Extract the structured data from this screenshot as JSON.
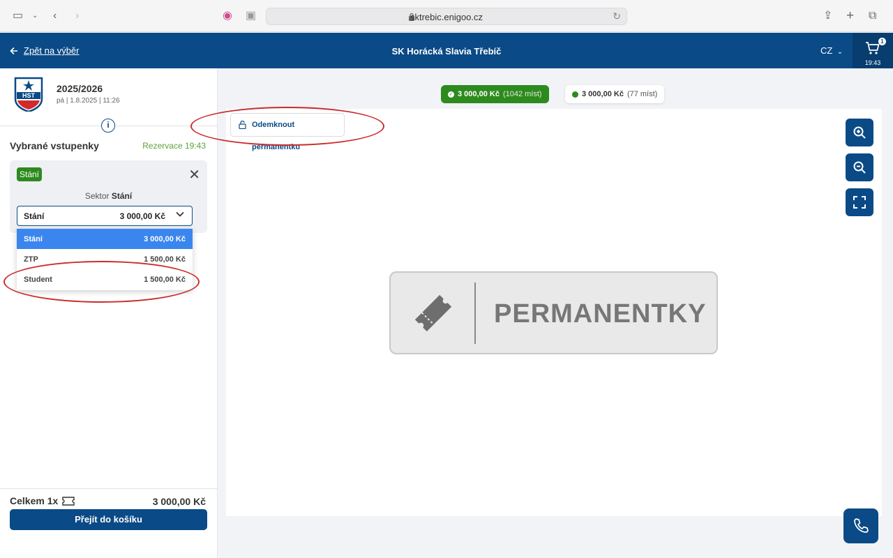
{
  "browser": {
    "url": "sktrebic.enigoo.cz"
  },
  "header": {
    "back_label": "Zpět na výběr",
    "title": "SK Horácká Slavia Třebíč",
    "language": "CZ",
    "cart_count": "1",
    "cart_timer": "19:43"
  },
  "event": {
    "crest_text": "HST",
    "season": "2025/2026",
    "date": "pá | 1.8.2025 | 11:26"
  },
  "selection": {
    "heading": "Vybrané vstupenky",
    "reservation": "Rezervace 19:43",
    "ticket_tag": "Stání",
    "sector_prefix": "Sektor",
    "sector_name": "Stání",
    "selected": {
      "name": "Stání",
      "price": "3 000,00 Kč"
    },
    "options": [
      {
        "name": "Stání",
        "price": "3 000,00 Kč"
      },
      {
        "name": "ZTP",
        "price": "1 500,00 Kč"
      },
      {
        "name": "Student",
        "price": "1 500,00 Kč"
      }
    ]
  },
  "summary": {
    "total_label": "Celkem 1x",
    "total_price": "3 000,00 Kč",
    "checkout_label": "Přejít do košíku"
  },
  "legend": [
    {
      "price": "3 000,00 Kč",
      "seats": "(1042 míst)"
    },
    {
      "price": "3 000,00 Kč",
      "seats": "(77 míst)"
    }
  ],
  "map": {
    "unlock_label": "Odemknout permanentku",
    "banner_text": "PERMANENTKY"
  },
  "colors": {
    "brand": "#0a4a86",
    "available": "#2d8a1e",
    "annotation": "#cc2b2b"
  }
}
